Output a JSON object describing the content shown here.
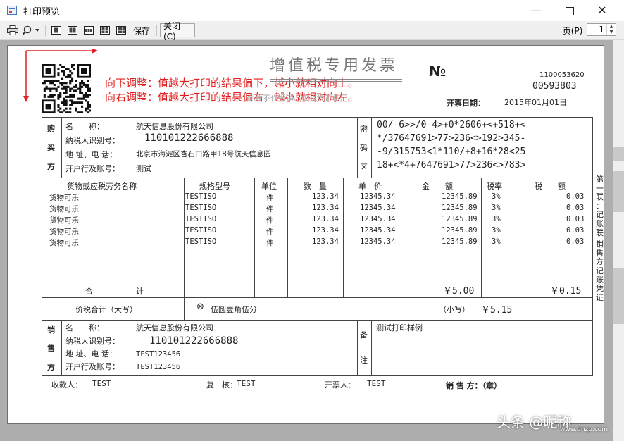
{
  "window": {
    "title": "打印预览",
    "minimize": "—",
    "maximize": "□",
    "close": "✕"
  },
  "toolbar": {
    "save_label": "保存",
    "close_label": "关闭(C)",
    "page_label": "页(P)",
    "page_value": "1",
    "icons": [
      "print-icon",
      "zoom-icon",
      "one-page-icon",
      "two-pages-icon",
      "three-pages-icon",
      "four-pages-icon",
      "six-pages-icon"
    ]
  },
  "annotations": {
    "down_note": "向下调整：值越大打印的结果偏下，越小就相对向上。",
    "right_note": "向右调整：值越大打印的结果偏右，越小就相对向左。"
  },
  "invoice": {
    "title": "增值税专用发票",
    "title_overlay": "此联不作报销、扣税凭证使用",
    "no_symbol": "№",
    "code": "1100053620",
    "number": "00593803",
    "date_label": "开票日期：",
    "date_value": "2015年01月01日",
    "buyer_section": [
      "购",
      "买",
      "方"
    ],
    "buyer_labels": [
      "名　　称：",
      "纳税人识别号：",
      "地 址、电 话：",
      "开户行及账号："
    ],
    "buyer_values": [
      "航天信息股份有限公司",
      "110101222666888",
      "北京市海淀区杏石口路甲18号航天信息园",
      "测试"
    ],
    "cipher_section": [
      "密",
      "码",
      "区"
    ],
    "cipher_lines": [
      "00/-6>>/0-4>+0*2606+<+518+<",
      "*/37647691>77>236<>192>345-",
      "-9/315753<1*110/+8+16*28<25",
      "18+<*4+7647691>77>236<>783>"
    ],
    "item_headers": [
      "货物或应税劳务名称",
      "规格型号",
      "单位",
      "数　量",
      "单　价",
      "金　　额",
      "税率",
      "税　　额"
    ],
    "items": [
      [
        "货物可乐",
        "TESTISO",
        "件",
        "123.34",
        "12345.34",
        "12345.89",
        "3%",
        "0.03"
      ],
      [
        "货物可乐",
        "TESTISO",
        "件",
        "123.34",
        "12345.34",
        "12345.89",
        "3%",
        "0.03"
      ],
      [
        "货物可乐",
        "TESTISO",
        "件",
        "123.34",
        "12345.34",
        "12345.89",
        "3%",
        "0.03"
      ],
      [
        "货物可乐",
        "TESTISO",
        "件",
        "123.34",
        "12345.34",
        "12345.89",
        "3%",
        "0.03"
      ],
      [
        "货物可乐",
        "TESTISO",
        "件",
        "123.34",
        "12345.34",
        "12345.89",
        "3%",
        "0.03"
      ]
    ],
    "total_label_1": "合",
    "total_label_2": "计",
    "total_amount": "￥5.00",
    "total_tax": "￥0.15",
    "grand_label": "价税合计（大写）",
    "grand_symbol": "⊗",
    "grand_upper": "伍圆壹角伍分",
    "grand_small_label": "（小写）",
    "grand_small_value": "￥5.15",
    "seller_section": [
      "销",
      "售",
      "方"
    ],
    "seller_labels": [
      "名　　称：",
      "纳税人识别号：",
      "地 址、电 话：",
      "开户行及账号："
    ],
    "seller_values": [
      "航天信息股份有限公司",
      "110101222666888",
      "TEST123456",
      "TEST123456"
    ],
    "remark_section": [
      "备",
      "注"
    ],
    "remark_value": "测试打印样例",
    "side_text": [
      "第",
      "一",
      "联",
      "：",
      "记",
      "账",
      "联",
      "",
      "销",
      "售",
      "方",
      "记",
      "账",
      "凭",
      "证"
    ],
    "payee_label": "收款人：",
    "payee_value": "TEST",
    "reviewer_label": "复　核：",
    "reviewer_value": "TEST",
    "drawer_label": "开票人：",
    "drawer_value": "TEST",
    "seller_stamp": "销 售 方：（章）"
  },
  "watermark": {
    "text": "头条 @昵称",
    "site": "www.dnzp.com"
  }
}
